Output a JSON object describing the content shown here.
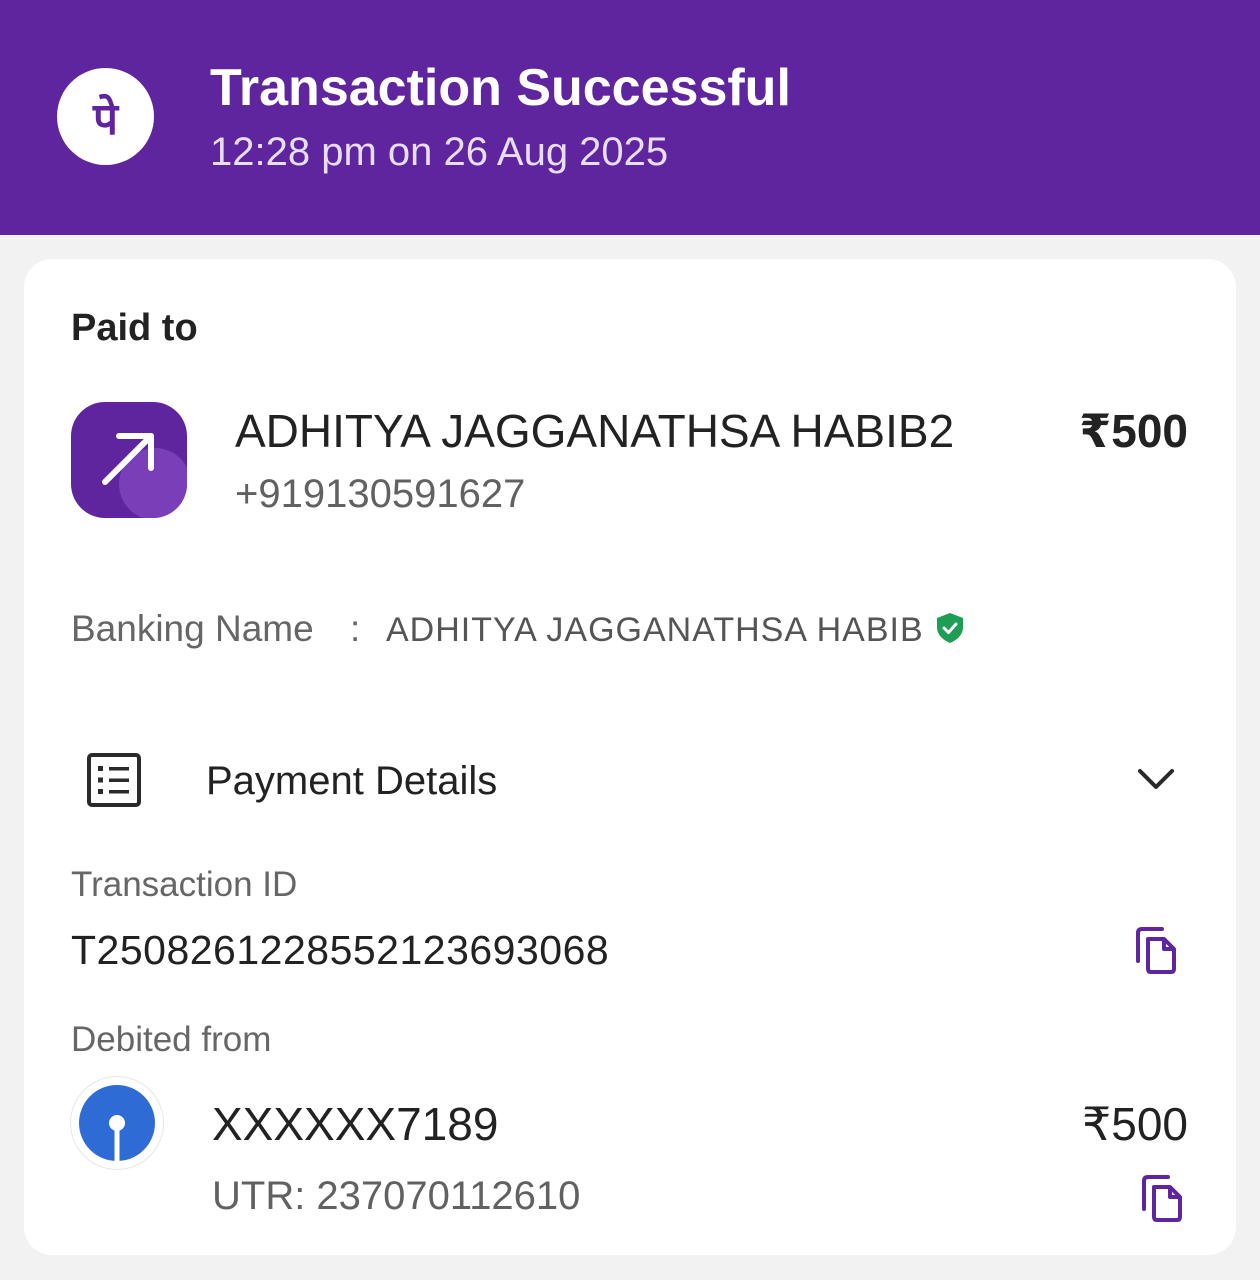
{
  "header": {
    "title": "Transaction Successful",
    "datetime": "12:28 pm on 26 Aug 2025",
    "logo_glyph": "पे",
    "logo_icon": "phonepe-logo-icon"
  },
  "paid_to": {
    "label": "Paid to",
    "icon": "arrow-up-right-icon",
    "name": "ADHITYA JAGGANATHSA HABIB2",
    "phone": "+919130591627",
    "amount": "₹500"
  },
  "banking_name": {
    "label": "Banking Name",
    "separator": ":",
    "value": "ADHITYA JAGGANATHSA HABIB",
    "verified_icon": "verified-shield-icon"
  },
  "payment_details": {
    "label": "Payment Details",
    "icon": "receipt-list-icon",
    "toggle_icon": "chevron-down-icon"
  },
  "transaction": {
    "label": "Transaction ID",
    "id": "T2508261228552123693068",
    "copy_icon": "copy-icon"
  },
  "debited_from": {
    "label": "Debited from",
    "bank_icon": "sbi-bank-logo-icon",
    "account": "XXXXXX7189",
    "utr": "UTR: 237070112610",
    "amount": "₹500",
    "copy_icon": "copy-icon"
  },
  "colors": {
    "brand": "#5f259f",
    "verified": "#1e9e54",
    "bank": "#2e6bd4"
  }
}
